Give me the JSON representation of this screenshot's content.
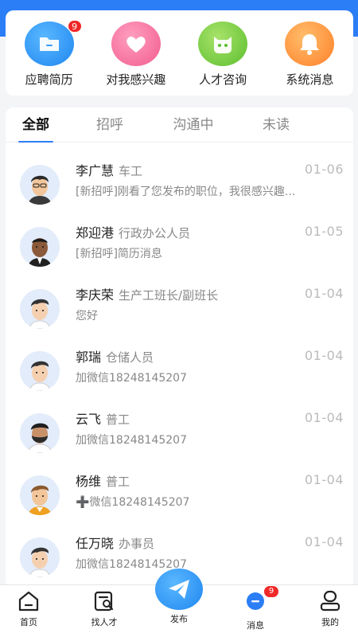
{
  "quick_actions": [
    {
      "label": "应聘简历",
      "icon": "folder-icon",
      "badge": "9"
    },
    {
      "label": "对我感兴趣",
      "icon": "heart-icon",
      "badge": ""
    },
    {
      "label": "人才咨询",
      "icon": "cat-chat-icon",
      "badge": ""
    },
    {
      "label": "系统消息",
      "icon": "bell-icon",
      "badge": ""
    }
  ],
  "tabs": [
    {
      "label": "全部",
      "active": true
    },
    {
      "label": "招呼",
      "active": false
    },
    {
      "label": "沟通中",
      "active": false
    },
    {
      "label": "未读",
      "active": false
    }
  ],
  "conversations": [
    {
      "name": "李广慧",
      "role": "车工",
      "date": "01-06",
      "message": "[新招呼]刚看了您发布的职位，我很感兴趣..."
    },
    {
      "name": "郑迎港",
      "role": "行政办公人员",
      "date": "01-05",
      "message": "[新招呼]简历消息"
    },
    {
      "name": "李庆荣",
      "role": "生产工班长/副班长",
      "date": "01-04",
      "message": "您好"
    },
    {
      "name": "郭瑞",
      "role": "仓储人员",
      "date": "01-04",
      "message": "加微信18248145207"
    },
    {
      "name": "云飞",
      "role": "普工",
      "date": "01-04",
      "message": "加微信18248145207"
    },
    {
      "name": "杨维",
      "role": "普工",
      "date": "01-04",
      "message": "➕微信18248145207"
    },
    {
      "name": "任万晓",
      "role": "办事员",
      "date": "01-04",
      "message": "加微信18248145207"
    }
  ],
  "bottom_nav": {
    "home": "首页",
    "find_talent": "找人才",
    "publish": "发布",
    "messages": "消息",
    "messages_badge": "9",
    "mine": "我的"
  },
  "colors": {
    "accent": "#2b7ef6",
    "badge": "#f02828"
  }
}
